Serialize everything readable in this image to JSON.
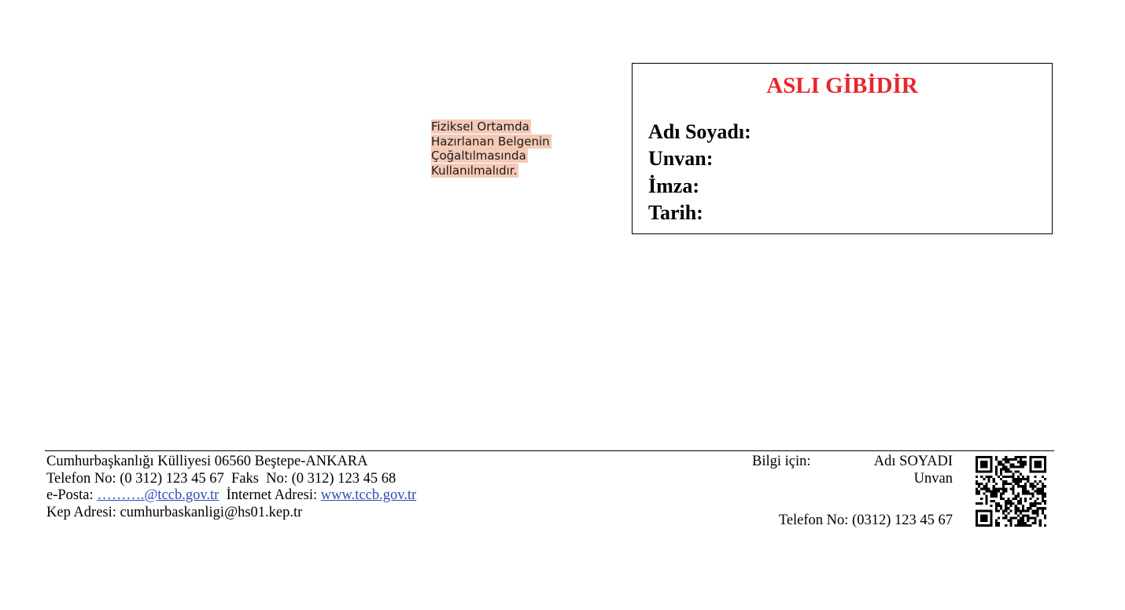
{
  "note": {
    "lines": [
      "Fiziksel Ortamda",
      "Hazırlanan Belgenin",
      "Çoğaltılmasında",
      "Kullanılmalıdır."
    ]
  },
  "stamp": {
    "title": "ASLI GİBİDİR",
    "title_color": "#e8262d",
    "fields": [
      "Adı Soyadı:",
      "Unvan:",
      "İmza:",
      "Tarih:"
    ]
  },
  "footer": {
    "address": "Cumhurbaşkanlığı Külliyesi 06560 Beştepe-ANKARA",
    "phone_fax": "Telefon No: (0 312) 123 45 67  Faks  No: (0 312) 123 45 68",
    "email_label": "e-Posta: ",
    "email_link": "……….@tccb.gov.tr",
    "web_label": "  İnternet Adresi: ",
    "web_link": "www.tccb.gov.tr",
    "kep": "Kep Adresi: cumhurbaskanligi@hs01.kep.tr",
    "link_color": "#2b4eb0"
  },
  "contact": {
    "label": "Bilgi için:",
    "name": "Adı SOYADI",
    "title": "Unvan",
    "phone": "Telefon No: (0312) 123 45 67"
  },
  "qr": {
    "icon": "qr-code-icon"
  }
}
